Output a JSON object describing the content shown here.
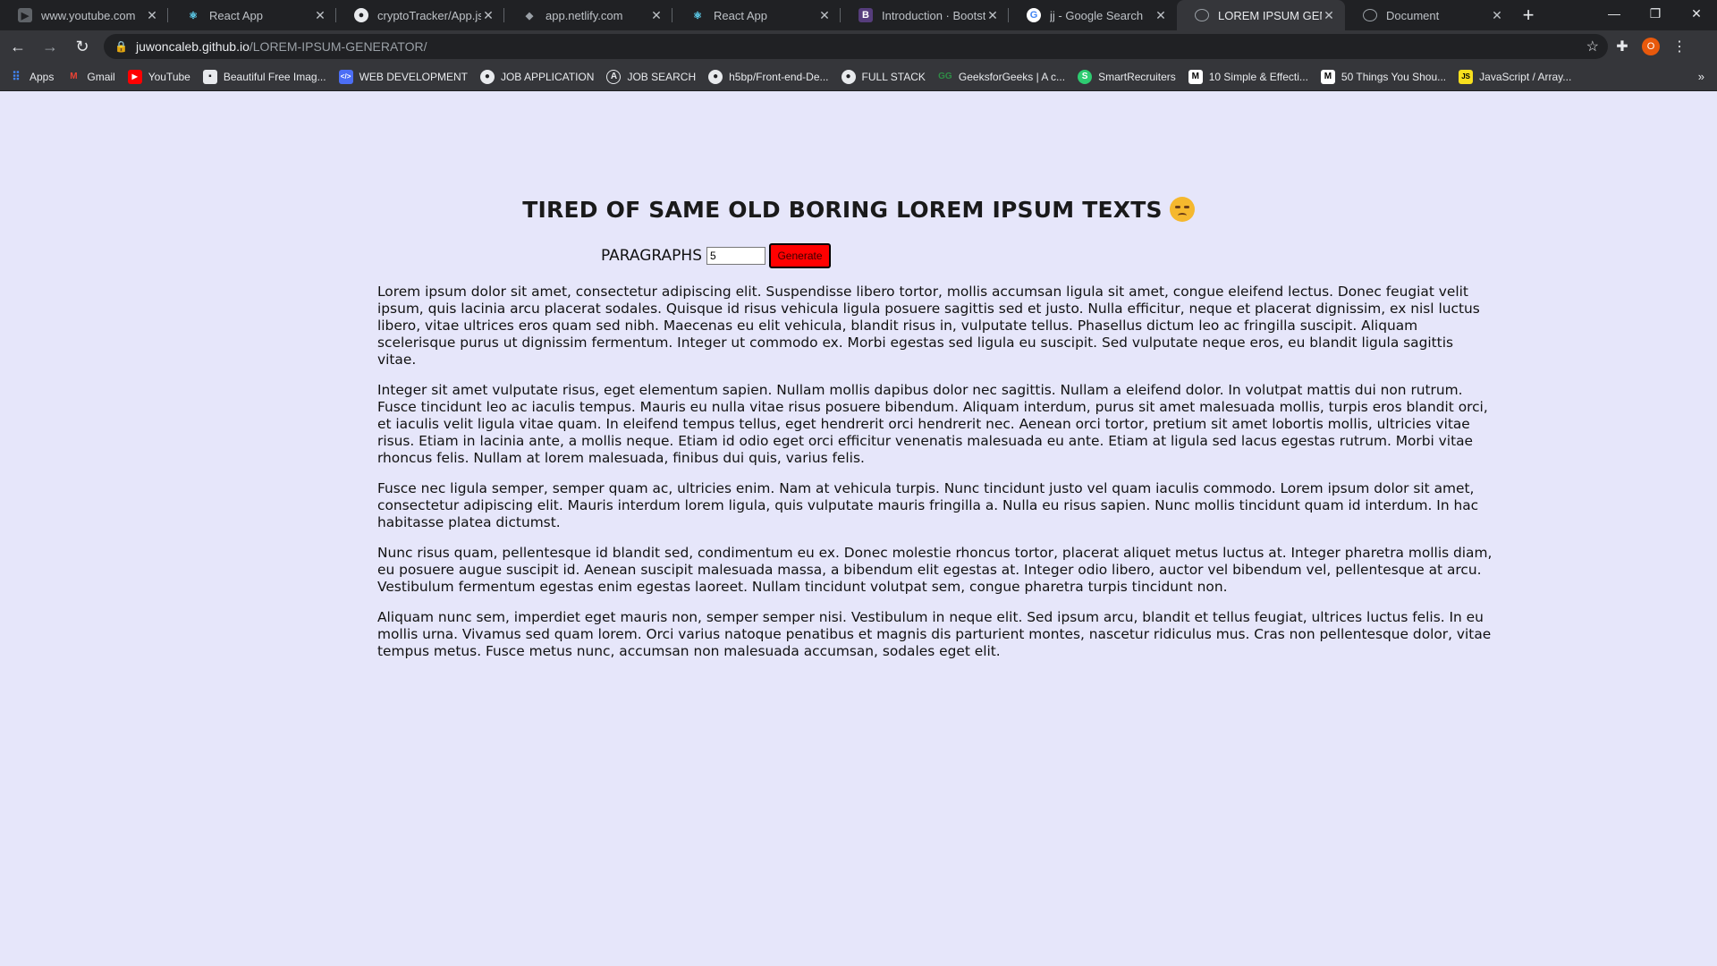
{
  "browser": {
    "tabs": [
      {
        "title": "www.youtube.com",
        "icon": "youtube-tab-icon",
        "active": false
      },
      {
        "title": "React App",
        "icon": "react-icon",
        "active": false
      },
      {
        "title": "cryptoTracker/App.js at",
        "icon": "github-icon",
        "active": false
      },
      {
        "title": "app.netlify.com",
        "icon": "netlify-icon",
        "active": false
      },
      {
        "title": "React App",
        "icon": "react-icon",
        "active": false
      },
      {
        "title": "Introduction · Bootstra",
        "icon": "bootstrap-icon",
        "active": false
      },
      {
        "title": "jj - Google Search",
        "icon": "google-icon",
        "active": false
      },
      {
        "title": "LOREM IPSUM GENERA",
        "icon": "globe-icon",
        "active": true
      },
      {
        "title": "Document",
        "icon": "globe-icon",
        "active": false
      }
    ],
    "url_host": "juwoncaleb.github.io",
    "url_path": "/LOREM-IPSUM-GENERATOR/",
    "profile_initial": "O",
    "bookmarks": [
      {
        "label": "Apps",
        "icon": "apps-grid-icon"
      },
      {
        "label": "Gmail",
        "icon": "gmail-icon"
      },
      {
        "label": "YouTube",
        "icon": "youtube-icon"
      },
      {
        "label": "Beautiful Free Imag...",
        "icon": "camera-icon"
      },
      {
        "label": "WEB DEVELOPMENT",
        "icon": "code-icon"
      },
      {
        "label": "JOB APPLICATION",
        "icon": "github-icon"
      },
      {
        "label": "JOB SEARCH",
        "icon": "angellist-icon"
      },
      {
        "label": "h5bp/Front-end-De...",
        "icon": "github-icon"
      },
      {
        "label": "FULL STACK",
        "icon": "github-icon"
      },
      {
        "label": "GeeksforGeeks | A c...",
        "icon": "geeksforgeeks-icon"
      },
      {
        "label": "SmartRecruiters",
        "icon": "smartrecruiters-icon"
      },
      {
        "label": "10 Simple & Effecti...",
        "icon": "medium-icon"
      },
      {
        "label": "50 Things You Shou...",
        "icon": "medium-icon"
      },
      {
        "label": "JavaScript / Array...",
        "icon": "js-icon"
      }
    ]
  },
  "page": {
    "heading": "TIRED OF SAME OLD BORING LOREM IPSUM TEXTS",
    "form": {
      "label": "PARAGRAPHS",
      "value": "5",
      "button": "Generate"
    },
    "paragraphs": [
      "Lorem ipsum dolor sit amet, consectetur adipiscing elit. Suspendisse libero tortor, mollis accumsan ligula sit amet, congue eleifend lectus. Donec feugiat velit ipsum, quis lacinia arcu placerat sodales. Quisque id risus vehicula ligula posuere sagittis sed et justo. Nulla efficitur, neque et placerat dignissim, ex nisl luctus libero, vitae ultrices eros quam sed nibh. Maecenas eu elit vehicula, blandit risus in, vulputate tellus. Phasellus dictum leo ac fringilla suscipit. Aliquam scelerisque purus ut dignissim fermentum. Integer ut commodo ex. Morbi egestas sed ligula eu suscipit. Sed vulputate neque eros, eu blandit ligula sagittis vitae.",
      "Integer sit amet vulputate risus, eget elementum sapien. Nullam mollis dapibus dolor nec sagittis. Nullam a eleifend dolor. In volutpat mattis dui non rutrum. Fusce tincidunt leo ac iaculis tempus. Mauris eu nulla vitae risus posuere bibendum. Aliquam interdum, purus sit amet malesuada mollis, turpis eros blandit orci, et iaculis velit ligula vitae quam. In eleifend tempus tellus, eget hendrerit orci hendrerit nec. Aenean orci tortor, pretium sit amet lobortis mollis, ultricies vitae risus. Etiam in lacinia ante, a mollis neque. Etiam id odio eget orci efficitur venenatis malesuada eu ante. Etiam at ligula sed lacus egestas rutrum. Morbi vitae rhoncus felis. Nullam at lorem malesuada, finibus dui quis, varius felis.",
      "Fusce nec ligula semper, semper quam ac, ultricies enim. Nam at vehicula turpis. Nunc tincidunt justo vel quam iaculis commodo. Lorem ipsum dolor sit amet, consectetur adipiscing elit. Mauris interdum lorem ligula, quis vulputate mauris fringilla a. Nulla eu risus sapien. Nunc mollis tincidunt quam id interdum. In hac habitasse platea dictumst.",
      "Nunc risus quam, pellentesque id blandit sed, condimentum eu ex. Donec molestie rhoncus tortor, placerat aliquet metus luctus at. Integer pharetra mollis diam, eu posuere augue suscipit id. Aenean suscipit malesuada massa, a bibendum elit egestas at. Integer odio libero, auctor vel bibendum vel, pellentesque at arcu. Vestibulum fermentum egestas enim egestas laoreet. Nullam tincidunt volutpat sem, congue pharetra turpis tincidunt non.",
      "Aliquam nunc sem, imperdiet eget mauris non, semper semper nisi. Vestibulum in neque elit. Sed ipsum arcu, blandit et tellus feugiat, ultrices luctus felis. In eu mollis urna. Vivamus sed quam lorem. Orci varius natoque penatibus et magnis dis parturient montes, nascetur ridiculus mus. Cras non pellentesque dolor, vitae tempus metus. Fusce metus nunc, accumsan non malesuada accumsan, sodales eget elit."
    ]
  },
  "colors": {
    "page_background": "#e6e6fa",
    "button_background": "#ff0000"
  }
}
